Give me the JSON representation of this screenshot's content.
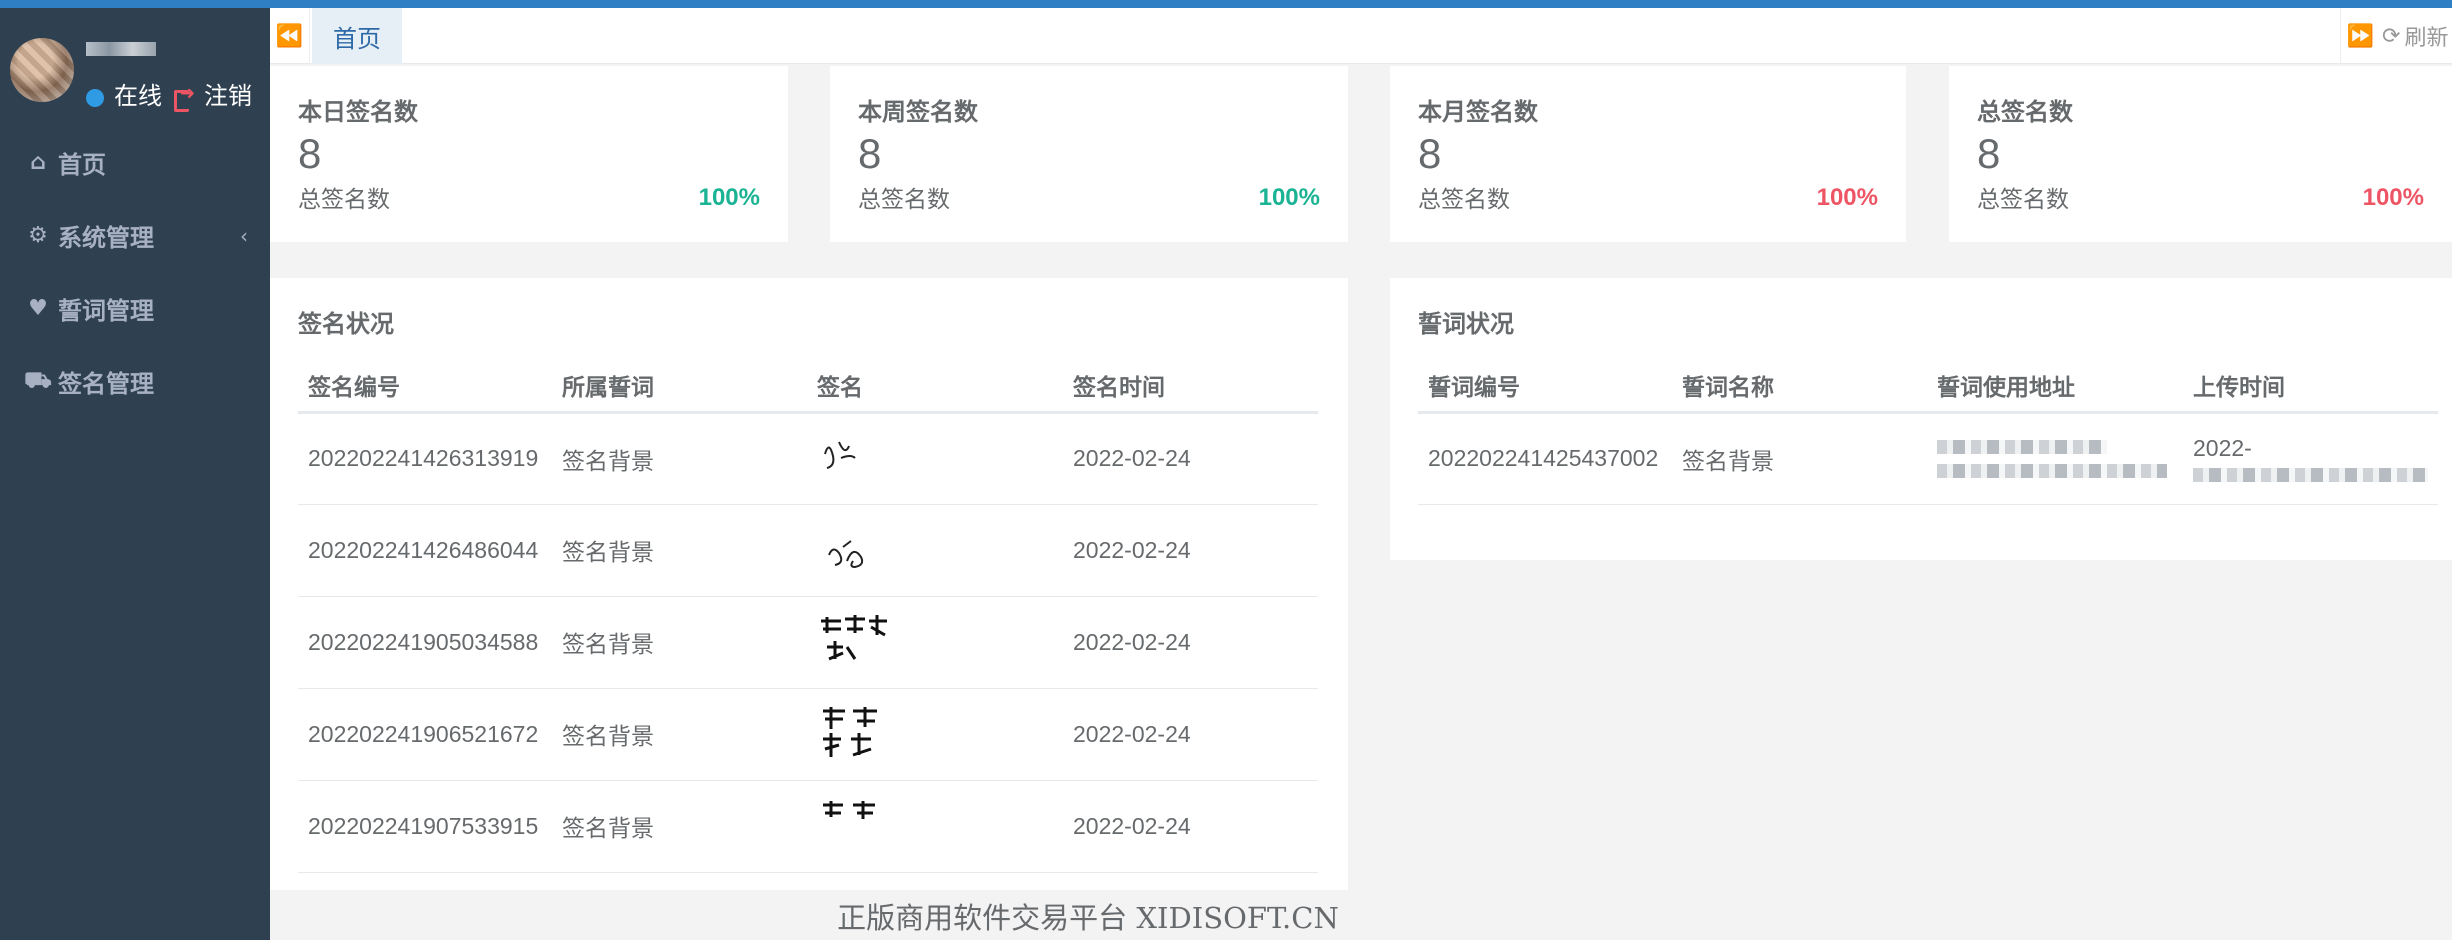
{
  "sidebar": {
    "status_online": "在线",
    "status_logout": "注销",
    "items": [
      {
        "icon": "home-icon",
        "label": "首页"
      },
      {
        "icon": "gear-icon",
        "label": "系统管理"
      },
      {
        "icon": "heart-icon",
        "label": "誓词管理"
      },
      {
        "icon": "car-icon",
        "label": "签名管理"
      }
    ]
  },
  "tabs": {
    "active": "首页",
    "refresh": "刷新"
  },
  "stats": [
    {
      "title": "本日签名数",
      "value": "8",
      "sub": "总签名数",
      "pct": "100%",
      "color": "#1ab394"
    },
    {
      "title": "本周签名数",
      "value": "8",
      "sub": "总签名数",
      "pct": "100%",
      "color": "#1ab394"
    },
    {
      "title": "本月签名数",
      "value": "8",
      "sub": "总签名数",
      "pct": "100%",
      "color": "#ed5565"
    },
    {
      "title": "总签名数",
      "value": "8",
      "sub": "总签名数",
      "pct": "100%",
      "color": "#ed5565"
    }
  ],
  "signatures": {
    "title": "签名状况",
    "headers": [
      "签名编号",
      "所属誓词",
      "签名",
      "签名时间"
    ],
    "rows": [
      {
        "id": "202202241426313919",
        "oath": "签名背景",
        "time": "2022-02-24"
      },
      {
        "id": "202202241426486044",
        "oath": "签名背景",
        "time": "2022-02-24"
      },
      {
        "id": "202202241905034588",
        "oath": "签名背景",
        "time": "2022-02-24"
      },
      {
        "id": "202202241906521672",
        "oath": "签名背景",
        "time": "2022-02-24"
      },
      {
        "id": "202202241907533915",
        "oath": "签名背景",
        "time": "2022-02-24"
      }
    ]
  },
  "oaths": {
    "title": "誓词状况",
    "headers": [
      "誓词编号",
      "誓词名称",
      "誓词使用地址",
      "上传时间"
    ],
    "rows": [
      {
        "id": "202202241425437002",
        "name": "签名背景",
        "time": "2022-"
      }
    ]
  },
  "footer": "正版商用软件交易平台 XIDISOFT.CN"
}
